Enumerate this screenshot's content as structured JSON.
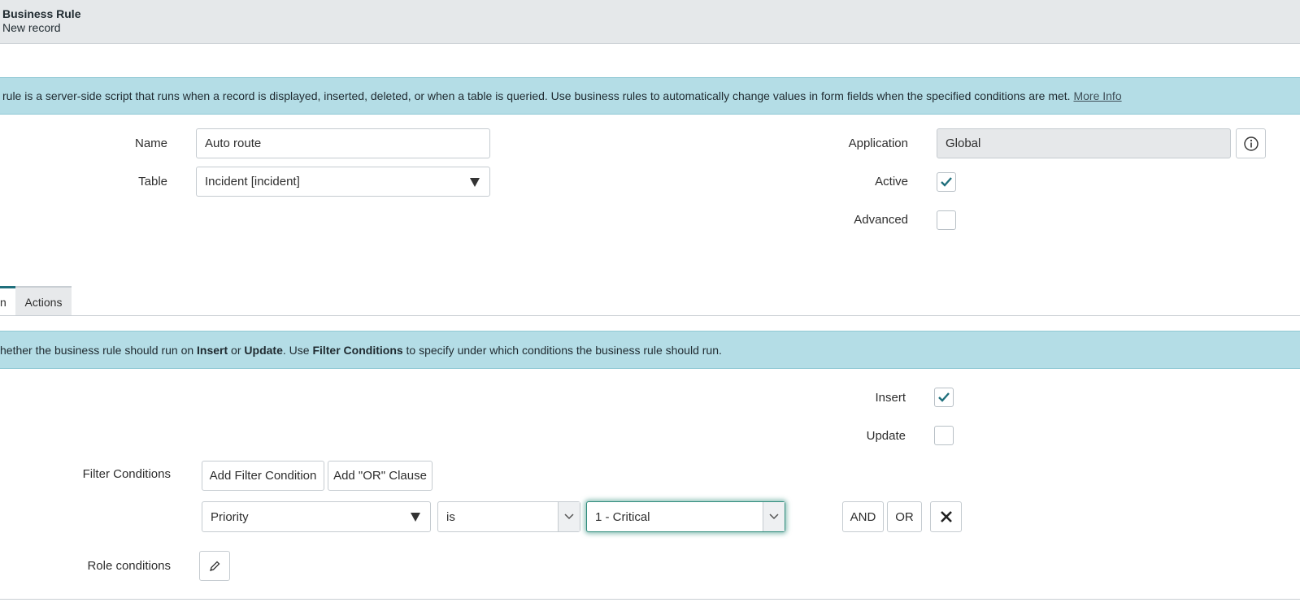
{
  "header": {
    "title": "Business Rule",
    "subtitle": "New record"
  },
  "info_banner": {
    "text": "rule is a server-side script that runs when a record is displayed, inserted, deleted, or when a table is queried. Use business rules to automatically change values in form fields when the specified conditions are met.",
    "link": "More Info"
  },
  "form": {
    "name_label": "Name",
    "name_value": "Auto route",
    "table_label": "Table",
    "table_value": "Incident [incident]",
    "application_label": "Application",
    "application_value": "Global",
    "active_label": "Active",
    "active_checked": true,
    "advanced_label": "Advanced",
    "advanced_checked": false
  },
  "tabs": [
    {
      "label": "n",
      "active": true
    },
    {
      "label": "Actions",
      "active": false
    }
  ],
  "when_banner": {
    "t1": "hether the business rule should run on ",
    "b1": "Insert",
    "t2": " or ",
    "b2": "Update",
    "t3": ". Use ",
    "b3": "Filter Conditions",
    "t4": " to specify under which conditions the business rule should run."
  },
  "when": {
    "insert_label": "Insert",
    "insert_checked": true,
    "update_label": "Update",
    "update_checked": false
  },
  "filter": {
    "label": "Filter Conditions",
    "add_condition": "Add Filter Condition",
    "add_or": "Add \"OR\" Clause",
    "field": "Priority",
    "operator": "is",
    "value": "1 - Critical",
    "and_label": "AND",
    "or_label": "OR"
  },
  "role": {
    "label": "Role conditions"
  },
  "colors": {
    "banner": "#b4dde6",
    "check": "#1f6f7c",
    "focus": "#2f8c7c"
  },
  "icons": {
    "info": "info-icon",
    "check": "check-icon",
    "remove": "close-icon",
    "edit": "pencil-icon"
  }
}
